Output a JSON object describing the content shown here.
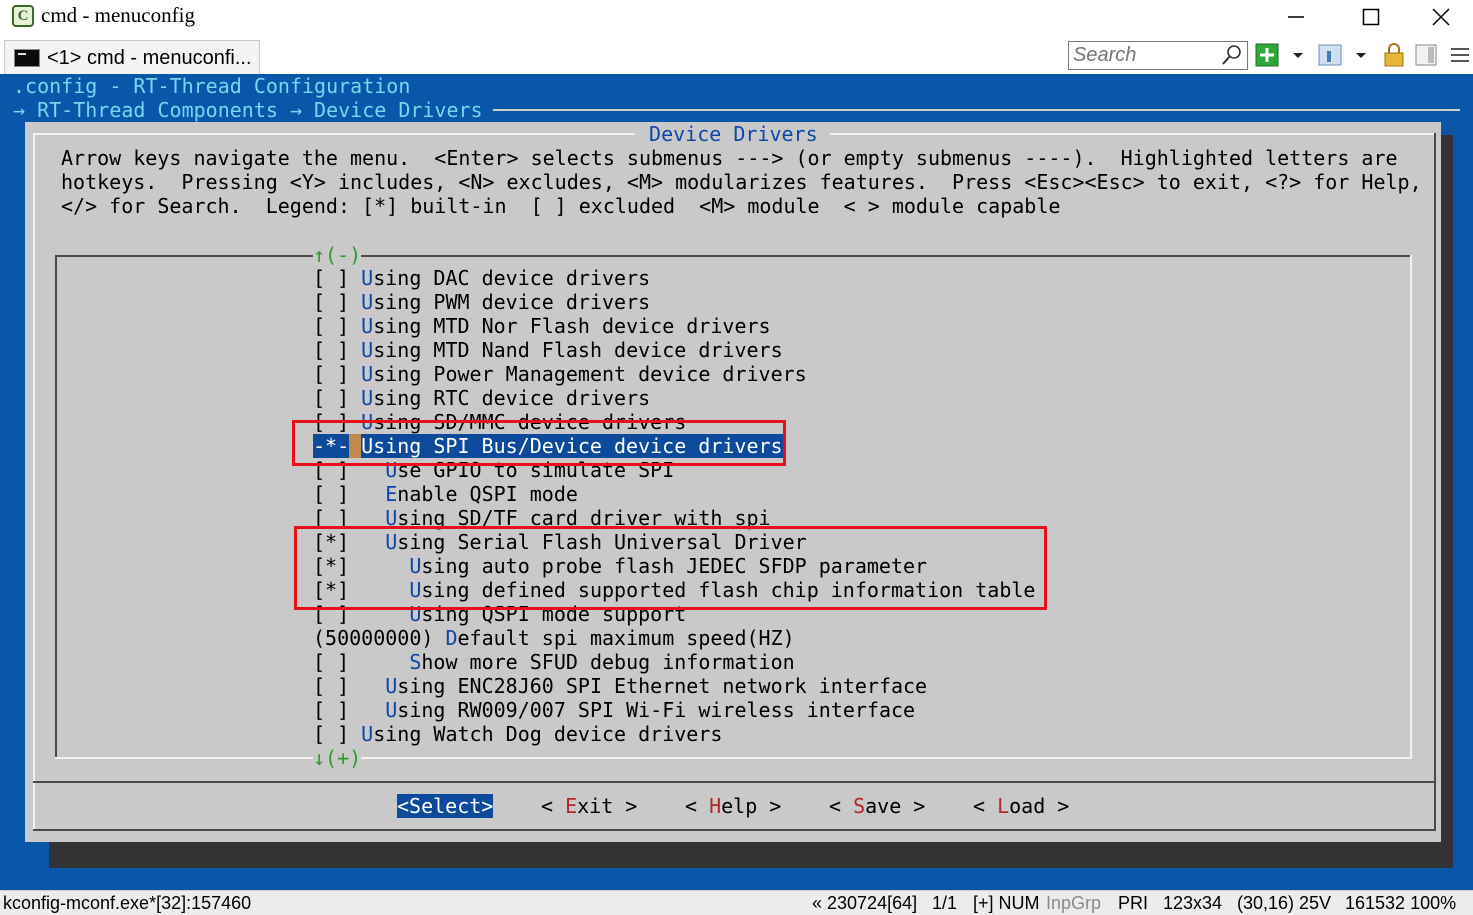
{
  "window": {
    "title": "cmd - menuconfig",
    "tab_label": "<1> cmd - menuconfi..."
  },
  "search": {
    "placeholder": "Search"
  },
  "terminal": {
    "line1": ".config - RT-Thread Configuration",
    "line2": "→ RT-Thread Components → Device Drivers",
    "dialog_title": " Device Drivers ",
    "help_lines": [
      "Arrow keys navigate the menu.  <Enter> selects submenus ---> (or empty submenus ----).  Highlighted letters are",
      "hotkeys.  Pressing <Y> includes, <N> excludes, <M> modularizes features.  Press <Esc><Esc> to exit, <?> for Help,",
      "</> for Search.  Legend: [*] built-in  [ ] excluded  <M> module  < > module capable"
    ],
    "scroll_up": "↑(-)",
    "scroll_down": "↓(+)",
    "menu_items": [
      {
        "prefix": "[ ] ",
        "hotkey": "U",
        "rest": "sing DAC device drivers"
      },
      {
        "prefix": "[ ] ",
        "hotkey": "U",
        "rest": "sing PWM device drivers"
      },
      {
        "prefix": "[ ] ",
        "hotkey": "U",
        "rest": "sing MTD Nor Flash device drivers"
      },
      {
        "prefix": "[ ] ",
        "hotkey": "U",
        "rest": "sing MTD Nand Flash device drivers"
      },
      {
        "prefix": "[ ] ",
        "hotkey": "U",
        "rest": "sing Power Management device drivers"
      },
      {
        "prefix": "[ ] ",
        "hotkey": "U",
        "rest": "sing RTC device drivers"
      },
      {
        "prefix": "[ ] ",
        "hotkey": "U",
        "rest": "sing SD/MMC device drivers"
      },
      {
        "prefix": "-*- ",
        "hotkey": "U",
        "rest": "sing SPI Bus/Device device drivers"
      },
      {
        "prefix": "[ ]   ",
        "hotkey": "U",
        "rest": "se GPIO to simulate SPI"
      },
      {
        "prefix": "[ ]   ",
        "hotkey": "E",
        "rest": "nable QSPI mode"
      },
      {
        "prefix": "[ ]   ",
        "hotkey": "U",
        "rest": "sing SD/TF card driver with spi"
      },
      {
        "prefix": "[*]   ",
        "hotkey": "U",
        "rest": "sing Serial Flash Universal Driver"
      },
      {
        "prefix": "[*]     ",
        "hotkey": "U",
        "rest": "sing auto probe flash JEDEC SFDP parameter"
      },
      {
        "prefix": "[*]     ",
        "hotkey": "U",
        "rest": "sing defined supported flash chip information table"
      },
      {
        "prefix": "[ ]     ",
        "hotkey": "U",
        "rest": "sing QSPI mode support"
      },
      {
        "prefix": "(50000000) ",
        "hotkey": "D",
        "rest": "efault spi maximum speed(HZ)"
      },
      {
        "prefix": "[ ]     ",
        "hotkey": "S",
        "rest": "how more SFUD debug information"
      },
      {
        "prefix": "[ ]   ",
        "hotkey": "U",
        "rest": "sing ENC28J60 SPI Ethernet network interface"
      },
      {
        "prefix": "[ ]   ",
        "hotkey": "U",
        "rest": "sing RW009/007 SPI Wi-Fi wireless interface"
      },
      {
        "prefix": "[ ] ",
        "hotkey": "U",
        "rest": "sing Watch Dog device drivers"
      }
    ],
    "selected_index": 7,
    "buttons": [
      {
        "pre": "<",
        "hotkey": "S",
        "rest": "elect>",
        "active": true
      },
      {
        "pre": "< ",
        "hotkey": "E",
        "rest": "xit >",
        "active": false
      },
      {
        "pre": "< ",
        "hotkey": "H",
        "rest": "elp >",
        "active": false
      },
      {
        "pre": "< ",
        "hotkey": "S",
        "rest": "ave >",
        "active": false
      },
      {
        "pre": "< ",
        "hotkey": "L",
        "rest": "oad >",
        "active": false
      }
    ]
  },
  "status": {
    "left": "kconfig-mconf.exe*[32]:157460",
    "fields": [
      "« 230724[64]",
      "1/1",
      "[+] NUM",
      "InpGrp",
      "PRI",
      "123x34",
      "(30,16) 25V",
      "161532 100%"
    ]
  },
  "colors": {
    "terminal_bg": "#0a56a8",
    "dialog_bg": "#c9c9c9",
    "selection_bg": "#0d4a9c",
    "hotkey": "#0d46a8",
    "button_hotkey": "#b3262b",
    "annotation_red": "#e8101a"
  },
  "icons": [
    "app-icon",
    "minimize-icon",
    "maximize-icon",
    "close-icon",
    "terminal-icon",
    "search-icon",
    "new-console-icon",
    "dropdown-icon",
    "view-icon",
    "lock-icon",
    "panel-icon",
    "menu-icon"
  ]
}
